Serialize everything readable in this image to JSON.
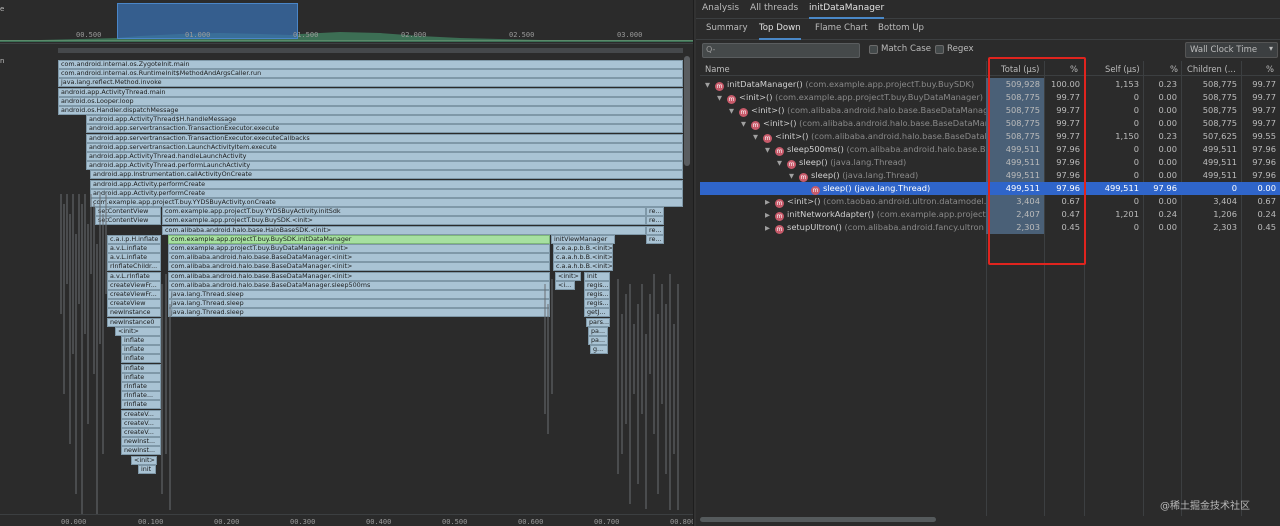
{
  "left": {
    "side_label_top": "e",
    "side_label_mid": "n",
    "minimap_ticks": [
      "00.500",
      "01.000",
      "01.500",
      "02.000",
      "02.500",
      "03.000"
    ],
    "time_ticks": [
      "00.000",
      "00.100",
      "00.200",
      "00.300",
      "00.400",
      "00.500",
      "00.600",
      "00.700",
      "00.800"
    ],
    "frames": [
      "com.android.internal.os.ZygoteInit.main",
      "com.android.internal.os.RuntimeInit$MethodAndArgsCaller.run",
      "java.lang.reflect.Method.invoke",
      "android.app.ActivityThread.main",
      "android.os.Looper.loop",
      "android.os.Handler.dispatchMessage",
      "android.app.ActivityThread$H.handleMessage",
      "android.app.servertransaction.TransactionExecutor.execute",
      "android.app.servertransaction.TransactionExecutor.executeCallbacks",
      "android.app.servertransaction.LaunchActivityItem.execute",
      "android.app.ActivityThread.handleLaunchActivity",
      "android.app.ActivityThread.performLaunchActivity",
      "android.app.Instrumentation.callActivityOnCreate",
      "android.app.Activity.performCreate",
      "android.app.Activity.performCreate",
      "com.example.app.projectT.buy.YYDSBuyActivity.onCreate"
    ],
    "f_setcontent1": "setContentView",
    "f_initsdk": "com.example.app.projectT.buy.YYDSBuyActivity.initSdk",
    "f_re1": "re...",
    "f_setcontent2": "setContentView",
    "f_buysdk_init": "com.example.app.projectT.buy.BuySDK.<init>",
    "f_re2": "re...",
    "f_halo_init": "com.alibaba.android.halo.base.HaloBaseSDK.<init>",
    "f_re3": "re...",
    "f_avl1": "a.v.L.inflate",
    "f_caip": "c.a.i.p.H.inflate",
    "f_initdm": "com.example.app.projectT.buy.BuySDK.initDataManager",
    "f_initview": "initViewManager",
    "f_re4": "re...",
    "f_avl2": "a.v.L.inflate",
    "f_buydm_init": "com.example.app.projectT.buy.BuyDataManager.<init>",
    "f_ceapbb": "c.e.a.p.b.B.<init>",
    "f_avl3": "a.v.L.inflate",
    "f_bdm_init1": "com.alibaba.android.halo.base.BaseDataManager.<init>",
    "f_caahbb1": "c.a.a.h.b.B.<init>",
    "f_rinflate_child": "rInflateChildr...",
    "f_bdm_init2": "com.alibaba.android.halo.base.BaseDataManager.<init>",
    "f_caahbb2": "c.a.a.h.b.B.<init>",
    "f_avl4": "a.v.L.rInflate",
    "f_bdm_init3": "com.alibaba.android.halo.base.BaseDataManager.<init>",
    "f_init_small": "<init>",
    "f_init_small2": "init",
    "f_createview_fr1": "createViewFr...",
    "f_sleep500": "com.alibaba.android.halo.base.BaseDataManager.sleep500ms",
    "f_lt_init": "<i...",
    "f_regis1": "regis...",
    "f_createview_fr2": "createViewFr...",
    "f_sleep1": "java.lang.Thread.sleep",
    "f_regis2": "regis...",
    "f_createview": "createView",
    "f_sleep2": "java.lang.Thread.sleep",
    "f_regis3": "regis...",
    "f_newinstance": "newInstance",
    "f_sleep3": "java.lang.Thread.sleep",
    "f_get": "getJ...",
    "f_newinstance0": "newInstance0",
    "f_pars": "pars...",
    "f_init2": "<init>",
    "f_pa1": "pa...",
    "f_inflate1": "inflate",
    "f_pa2": "pa...",
    "f_inflate2": "inflate",
    "f_g": "g...",
    "f_inflate3": "inflate",
    "f_inflate4": "inflate",
    "f_inflate5": "inflate",
    "f_rinflate1": "rInflate",
    "f_rinflate2": "rInflate...",
    "f_rinflate3": "rInflate",
    "f_createv1": "createV...",
    "f_createv2": "createV...",
    "f_createv3": "createV...",
    "f_newinst1": "newInst...",
    "f_newinst2": "newInst...",
    "f_init3": "<init>",
    "f_init4": "init"
  },
  "right": {
    "tabs": [
      "Analysis",
      "All threads",
      "initDataManager"
    ],
    "subtabs": [
      "Summary",
      "Top Down",
      "Flame Chart",
      "Bottom Up"
    ],
    "search_placeholder": "Q-",
    "match_case": "Match Case",
    "regex": "Regex",
    "clock": "Wall Clock Time",
    "headers": {
      "name": "Name",
      "total": "Total (μs)",
      "pct": "%",
      "self": "Self (μs)",
      "pct2": "%",
      "children": "Children (...",
      "pct3": "%"
    },
    "rows": [
      {
        "tri": "▼",
        "name": "initDataManager()",
        "pkg": "(com.example.app.projectT.buy.BuySDK)",
        "total": "509,928",
        "p1": "100.00",
        "self": "1,153",
        "p2": "0.23",
        "children": "508,775",
        "p3": "99.77"
      },
      {
        "tri": "▼",
        "name": "<init>()",
        "pkg": "(com.example.app.projectT.buy.BuyDataManager)",
        "total": "508,775",
        "p1": "99.77",
        "self": "0",
        "p2": "0.00",
        "children": "508,775",
        "p3": "99.77"
      },
      {
        "tri": "▼",
        "name": "<init>()",
        "pkg": "(com.alibaba.android.halo.base.BaseDataManage",
        "total": "508,775",
        "p1": "99.77",
        "self": "0",
        "p2": "0.00",
        "children": "508,775",
        "p3": "99.77"
      },
      {
        "tri": "▼",
        "name": "<init>()",
        "pkg": "(com.alibaba.android.halo.base.BaseDataMana",
        "total": "508,775",
        "p1": "99.77",
        "self": "0",
        "p2": "0.00",
        "children": "508,775",
        "p3": "99.77"
      },
      {
        "tri": "▼",
        "name": "<init>()",
        "pkg": "(com.alibaba.android.halo.base.BaseDataM",
        "total": "508,775",
        "p1": "99.77",
        "self": "1,150",
        "p2": "0.23",
        "children": "507,625",
        "p3": "99.55"
      },
      {
        "tri": "▼",
        "name": "sleep500ms()",
        "pkg": "(com.alibaba.android.halo.base.Base",
        "total": "499,511",
        "p1": "97.96",
        "self": "0",
        "p2": "0.00",
        "children": "499,511",
        "p3": "97.96"
      },
      {
        "tri": "▼",
        "name": "sleep()",
        "pkg": "(java.lang.Thread)",
        "total": "499,511",
        "p1": "97.96",
        "self": "0",
        "p2": "0.00",
        "children": "499,511",
        "p3": "97.96"
      },
      {
        "tri": "▼",
        "name": "sleep()",
        "pkg": "(java.lang.Thread)",
        "total": "499,511",
        "p1": "97.96",
        "self": "0",
        "p2": "0.00",
        "children": "499,511",
        "p3": "97.96"
      },
      {
        "tri": "",
        "name": "sleep()",
        "pkg": "(java.lang.Thread)",
        "total": "499,511",
        "p1": "97.96",
        "self": "499,511",
        "p2": "97.96",
        "children": "0",
        "p3": "0.00"
      },
      {
        "tri": "▶",
        "name": "<init>()",
        "pkg": "(com.taobao.android.ultron.datamodel.",
        "total": "3,404",
        "p1": "0.67",
        "self": "0",
        "p2": "0.00",
        "children": "3,404",
        "p3": "0.67"
      },
      {
        "tri": "▶",
        "name": "initNetworkAdapter()",
        "pkg": "(com.example.app.project",
        "total": "2,407",
        "p1": "0.47",
        "self": "1,201",
        "p2": "0.24",
        "children": "1,206",
        "p3": "0.24"
      },
      {
        "tri": "▶",
        "name": "setupUltron()",
        "pkg": "(com.alibaba.android.fancy.ultron",
        "total": "2,303",
        "p1": "0.45",
        "self": "0",
        "p2": "0.00",
        "children": "2,303",
        "p3": "0.45"
      }
    ]
  },
  "watermark": "@稀土掘金技术社区"
}
